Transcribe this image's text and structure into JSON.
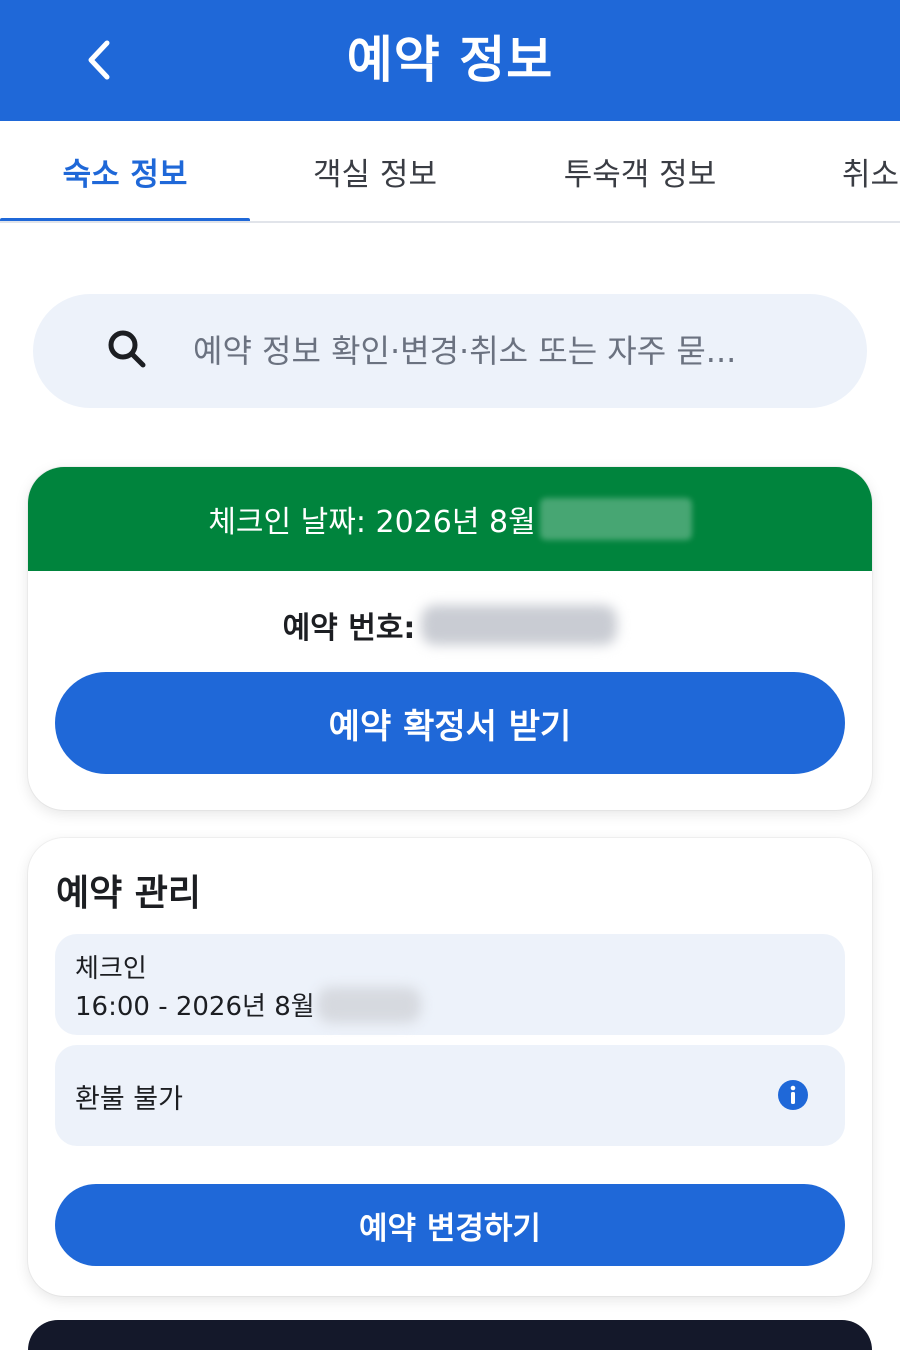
{
  "header": {
    "back_icon": "chevron-left-icon",
    "title": "예약 정보",
    "bg_color": "#1f68d8"
  },
  "tabs": [
    {
      "label": "숙소 정보",
      "active": true
    },
    {
      "label": "객실 정보",
      "active": false
    },
    {
      "label": "투숙객 정보",
      "active": false
    },
    {
      "label": "취소",
      "active": false
    }
  ],
  "search": {
    "icon": "search-icon",
    "placeholder": "예약 정보 확인·변경·취소 또는 자주 묻..."
  },
  "reservation_card": {
    "checkin_banner": "체크인 날짜: 2026년 8월",
    "banner_color": "#00843d",
    "reservation_number_label": "예약 번호:",
    "confirm_button": "예약 확정서 받기"
  },
  "manage_card": {
    "title": "예약 관리",
    "checkin_label": "체크인",
    "checkin_value": "16:00 - 2026년 8월",
    "refund_label": "환불 불가",
    "info_icon": "info-icon",
    "change_button": "예약 변경하기"
  }
}
